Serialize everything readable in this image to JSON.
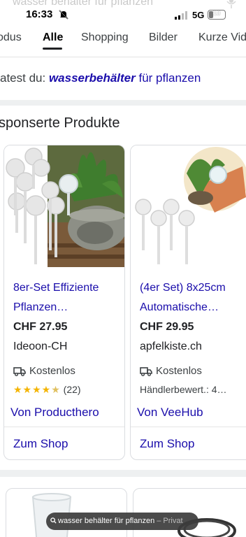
{
  "search": {
    "query": "wasser behälter für pflanzen"
  },
  "status_bar": {
    "time": "16:33",
    "network": "5G",
    "battery": "10"
  },
  "tabs": [
    {
      "label": "odus"
    },
    {
      "label": "Alle"
    },
    {
      "label": "Shopping"
    },
    {
      "label": "Bilder"
    },
    {
      "label": "Kurze Vid"
    }
  ],
  "suggestion": {
    "prefix": "atest du:",
    "bold": "wasserbehälter",
    "rest": "für pflanzen"
  },
  "section": {
    "title": "sponserte Produkte"
  },
  "products": [
    {
      "title_line1": "8er-Set Effiziente",
      "title_line2": "Pflanzen…",
      "price": "CHF 27.95",
      "store": "Ideoon-CH",
      "shipping": "Kostenlos",
      "rating_stars": "★★★★",
      "rating_half": "★",
      "rating_count": "(22)",
      "merchant": "Von Producthero",
      "shop": "Zum Shop"
    },
    {
      "title_line1": "(4er Set) 8x25cm",
      "title_line2": "Automatische…",
      "price": "CHF 29.95",
      "store": "apfelkiste.ch",
      "shipping": "Kostenlos",
      "dealer_rating": "Händlerbewert.: 4…",
      "merchant": "Von VeeHub",
      "shop": "Zum Shop"
    }
  ],
  "bottom_pill": {
    "query": "wasser behälter für pflanzen",
    "sep": " – ",
    "mode": "Privat"
  },
  "colors": {
    "link": "#1a0dab",
    "star": "#f4b400",
    "divider": "#eef0f1"
  }
}
